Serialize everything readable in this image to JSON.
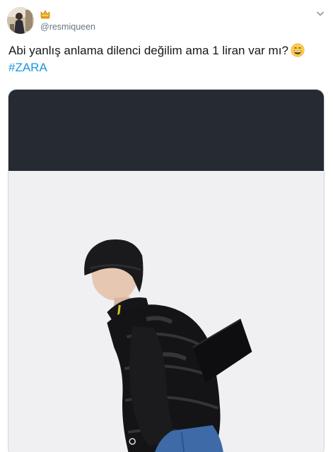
{
  "tweet": {
    "handle": "@resmiqueen",
    "text_line1": "Abi yanlış anlama dilenci değilim ama 1 liran var mı?",
    "hashtag": "#ZARA"
  },
  "icons": {
    "badge": "crown-icon",
    "menu": "chevron-down-icon",
    "emoji": "grinning-face-icon"
  },
  "colors": {
    "hashtag": "#1b95e0",
    "handle": "#657786",
    "media_top": "#252a33"
  }
}
